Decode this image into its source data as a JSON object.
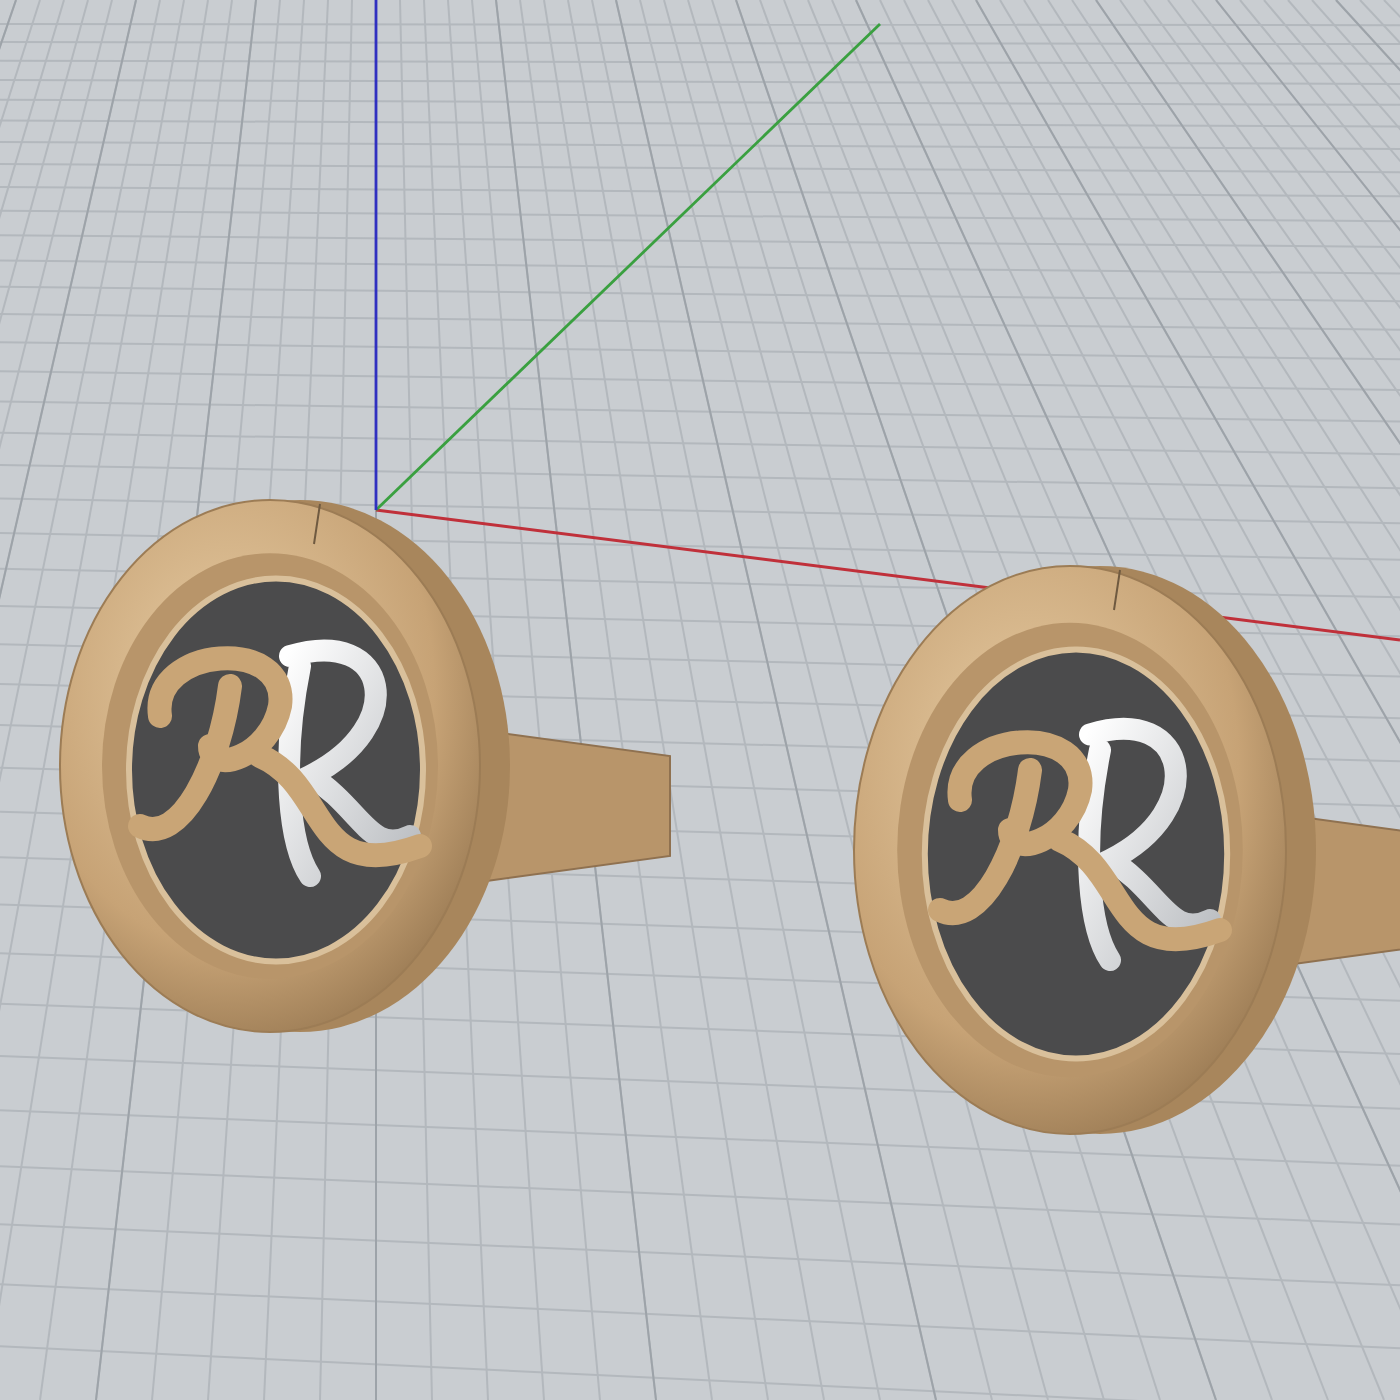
{
  "viewport": {
    "grid": true,
    "axes": [
      {
        "color": "#c0303a"
      },
      {
        "color": "#3aa040"
      },
      {
        "color": "#3030c0"
      }
    ]
  },
  "objects": [
    {
      "kind": "cufflink"
    },
    {
      "kind": "cufflink"
    }
  ]
}
